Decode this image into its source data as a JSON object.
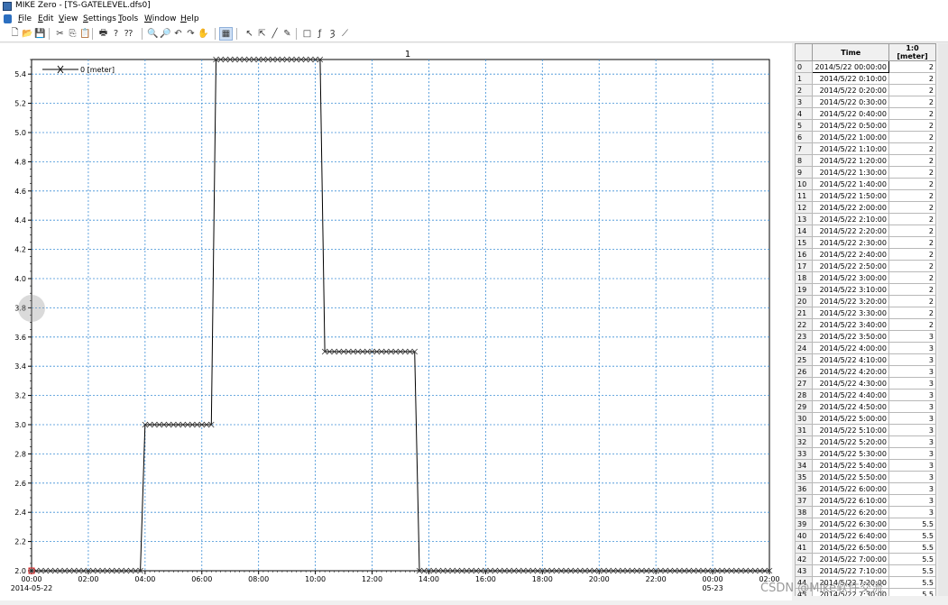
{
  "app": {
    "title": "MIKE Zero - [TS-GATELEVEL.dfs0]"
  },
  "menu": [
    {
      "key": "F",
      "rest": "ile"
    },
    {
      "key": "E",
      "rest": "dit"
    },
    {
      "key": "V",
      "rest": "iew"
    },
    {
      "key": "S",
      "rest": "ettings"
    },
    {
      "key": "T",
      "rest": "ools"
    },
    {
      "key": "W",
      "rest": "indow"
    },
    {
      "key": "H",
      "rest": "elp"
    }
  ],
  "toolbar": {
    "icons": [
      "new-icon",
      "open-icon",
      "save-icon",
      "cut-icon",
      "copy-icon",
      "paste-icon",
      "print-icon",
      "help-icon",
      "context-help-icon",
      "zoom-in-icon",
      "zoom-out-icon",
      "zoom-previous-icon",
      "zoom-next-icon",
      "pan-icon",
      "grid-toggle-icon",
      "select-pointer-icon",
      "select-points-icon",
      "draw-line-icon",
      "edit-values-icon",
      "rectangle-icon",
      "function-icon",
      "properties-icon",
      "ruler-icon"
    ],
    "glyphs": [
      "🗋",
      "📂",
      "💾",
      "✂",
      "⎘",
      "📋",
      "🖶",
      "?",
      "⁇",
      "🔍",
      "🔎",
      "↶",
      "↷",
      "✋",
      "▦",
      "↖",
      "⇱",
      "╱",
      "✎",
      "□",
      "ƒ",
      "Ȝ",
      "⟋"
    ],
    "active_index": 14
  },
  "chart_data": {
    "type": "line",
    "title": "1",
    "xlabel": "",
    "ylabel": "",
    "ylim": [
      2.0,
      5.5
    ],
    "grid": true,
    "legend": {
      "position": "top-left",
      "entries": [
        "0 [meter]"
      ]
    },
    "series": [
      {
        "name": "0 [meter]",
        "marker": "x",
        "color": "#000000",
        "x": [
          "2014-05-22 00:00",
          "2014-05-22 03:50",
          "2014-05-22 04:00",
          "2014-05-22 06:20",
          "2014-05-22 06:30",
          "2014-05-22 10:10",
          "2014-05-22 10:20",
          "2014-05-22 13:30",
          "2014-05-22 13:40",
          "2014-05-23 02:00"
        ],
        "y": [
          2,
          2,
          3,
          3,
          5.5,
          5.5,
          3.5,
          3.5,
          2,
          2
        ]
      }
    ],
    "x_ticks": [
      {
        "label": "00:00",
        "sub": "2014-05-22"
      },
      {
        "label": "02:00",
        "sub": ""
      },
      {
        "label": "04:00",
        "sub": ""
      },
      {
        "label": "06:00",
        "sub": ""
      },
      {
        "label": "08:00",
        "sub": ""
      },
      {
        "label": "10:00",
        "sub": ""
      },
      {
        "label": "12:00",
        "sub": ""
      },
      {
        "label": "14:00",
        "sub": ""
      },
      {
        "label": "16:00",
        "sub": ""
      },
      {
        "label": "18:00",
        "sub": ""
      },
      {
        "label": "20:00",
        "sub": ""
      },
      {
        "label": "22:00",
        "sub": ""
      },
      {
        "label": "00:00",
        "sub": "05-23"
      },
      {
        "label": "02:00",
        "sub": ""
      }
    ],
    "y_ticks": [
      "2.0",
      "2.2",
      "2.4",
      "2.6",
      "2.8",
      "3.0",
      "3.2",
      "3.4",
      "3.6",
      "3.8",
      "4.0",
      "4.2",
      "4.4",
      "4.6",
      "4.8",
      "5.0",
      "5.2",
      "5.4"
    ]
  },
  "table": {
    "headers": [
      "",
      "Time",
      "1:0 [meter]"
    ],
    "rows": [
      [
        "0",
        "2014/5/22 00:00:00",
        "2"
      ],
      [
        "1",
        "2014/5/22 0:10:00",
        "2"
      ],
      [
        "2",
        "2014/5/22 0:20:00",
        "2"
      ],
      [
        "3",
        "2014/5/22 0:30:00",
        "2"
      ],
      [
        "4",
        "2014/5/22 0:40:00",
        "2"
      ],
      [
        "5",
        "2014/5/22 0:50:00",
        "2"
      ],
      [
        "6",
        "2014/5/22 1:00:00",
        "2"
      ],
      [
        "7",
        "2014/5/22 1:10:00",
        "2"
      ],
      [
        "8",
        "2014/5/22 1:20:00",
        "2"
      ],
      [
        "9",
        "2014/5/22 1:30:00",
        "2"
      ],
      [
        "10",
        "2014/5/22 1:40:00",
        "2"
      ],
      [
        "11",
        "2014/5/22 1:50:00",
        "2"
      ],
      [
        "12",
        "2014/5/22 2:00:00",
        "2"
      ],
      [
        "13",
        "2014/5/22 2:10:00",
        "2"
      ],
      [
        "14",
        "2014/5/22 2:20:00",
        "2"
      ],
      [
        "15",
        "2014/5/22 2:30:00",
        "2"
      ],
      [
        "16",
        "2014/5/22 2:40:00",
        "2"
      ],
      [
        "17",
        "2014/5/22 2:50:00",
        "2"
      ],
      [
        "18",
        "2014/5/22 3:00:00",
        "2"
      ],
      [
        "19",
        "2014/5/22 3:10:00",
        "2"
      ],
      [
        "20",
        "2014/5/22 3:20:00",
        "2"
      ],
      [
        "21",
        "2014/5/22 3:30:00",
        "2"
      ],
      [
        "22",
        "2014/5/22 3:40:00",
        "2"
      ],
      [
        "23",
        "2014/5/22 3:50:00",
        "3"
      ],
      [
        "24",
        "2014/5/22 4:00:00",
        "3"
      ],
      [
        "25",
        "2014/5/22 4:10:00",
        "3"
      ],
      [
        "26",
        "2014/5/22 4:20:00",
        "3"
      ],
      [
        "27",
        "2014/5/22 4:30:00",
        "3"
      ],
      [
        "28",
        "2014/5/22 4:40:00",
        "3"
      ],
      [
        "29",
        "2014/5/22 4:50:00",
        "3"
      ],
      [
        "30",
        "2014/5/22 5:00:00",
        "3"
      ],
      [
        "31",
        "2014/5/22 5:10:00",
        "3"
      ],
      [
        "32",
        "2014/5/22 5:20:00",
        "3"
      ],
      [
        "33",
        "2014/5/22 5:30:00",
        "3"
      ],
      [
        "34",
        "2014/5/22 5:40:00",
        "3"
      ],
      [
        "35",
        "2014/5/22 5:50:00",
        "3"
      ],
      [
        "36",
        "2014/5/22 6:00:00",
        "3"
      ],
      [
        "37",
        "2014/5/22 6:10:00",
        "3"
      ],
      [
        "38",
        "2014/5/22 6:20:00",
        "3"
      ],
      [
        "39",
        "2014/5/22 6:30:00",
        "5.5"
      ],
      [
        "40",
        "2014/5/22 6:40:00",
        "5.5"
      ],
      [
        "41",
        "2014/5/22 6:50:00",
        "5.5"
      ],
      [
        "42",
        "2014/5/22 7:00:00",
        "5.5"
      ],
      [
        "43",
        "2014/5/22 7:10:00",
        "5.5"
      ],
      [
        "44",
        "2014/5/22 7:20:00",
        "5.5"
      ],
      [
        "45",
        "2014/5/22 7:30:00",
        "5.5"
      ]
    ]
  },
  "watermark": "CSDN @Mike软件交流"
}
